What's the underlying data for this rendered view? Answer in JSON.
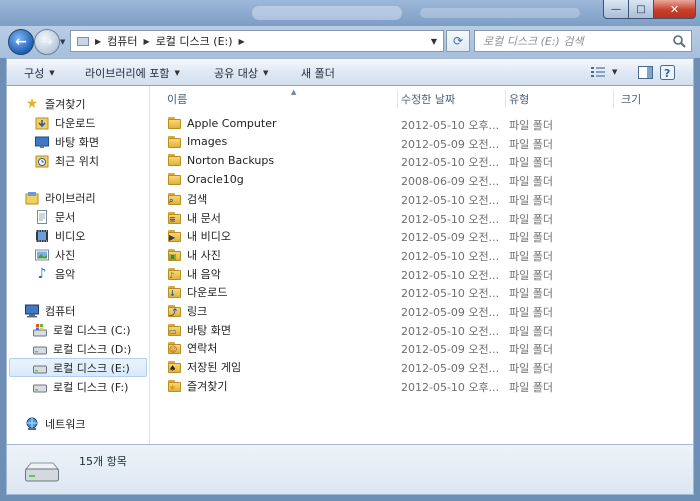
{
  "window": {
    "minimize_glyph": "—",
    "maximize_glyph": "□",
    "close_glyph": "✕"
  },
  "address": {
    "crumbs": [
      "컴퓨터",
      "로컬 디스크 (E:)"
    ]
  },
  "search": {
    "placeholder": "로컬 디스크 (E:) 검색"
  },
  "toolbar": {
    "organize": "구성",
    "include_library": "라이브러리에 포함",
    "share": "공유 대상",
    "new_folder": "새 폴더"
  },
  "nav": {
    "favorites": {
      "label": "즐겨찾기",
      "icon": "star-icon"
    },
    "favorites_items": [
      {
        "label": "다운로드",
        "icon": "downloads-folder-icon"
      },
      {
        "label": "바탕 화면",
        "icon": "desktop-icon"
      },
      {
        "label": "최근 위치",
        "icon": "recent-places-icon"
      }
    ],
    "libraries": {
      "label": "라이브러리",
      "icon": "libraries-icon"
    },
    "library_items": [
      {
        "label": "문서",
        "icon": "documents-icon"
      },
      {
        "label": "비디오",
        "icon": "videos-icon"
      },
      {
        "label": "사진",
        "icon": "pictures-icon"
      },
      {
        "label": "음악",
        "icon": "music-icon"
      }
    ],
    "computer": {
      "label": "컴퓨터",
      "icon": "computer-icon"
    },
    "drives": [
      {
        "label": "로컬 디스크 (C:)",
        "icon": "windows-drive-icon"
      },
      {
        "label": "로컬 디스크 (D:)",
        "icon": "drive-icon"
      },
      {
        "label": "로컬 디스크 (E:)",
        "icon": "drive-icon",
        "selected": true
      },
      {
        "label": "로컬 디스크 (F:)",
        "icon": "drive-icon"
      }
    ],
    "network": {
      "label": "네트워크",
      "icon": "network-icon"
    }
  },
  "columns": {
    "name": "이름",
    "modified": "수정한 날짜",
    "type": "유형",
    "size": "크기"
  },
  "files": [
    {
      "name": "Apple Computer",
      "date": "2012-05-10 오후...",
      "type": "파일 폴더",
      "icon": "folder-icon"
    },
    {
      "name": "Images",
      "date": "2012-05-09 오전...",
      "type": "파일 폴더",
      "icon": "folder-icon"
    },
    {
      "name": "Norton Backups",
      "date": "2012-05-10 오전...",
      "type": "파일 폴더",
      "icon": "folder-icon"
    },
    {
      "name": "Oracle10g",
      "date": "2008-06-09 오전...",
      "type": "파일 폴더",
      "icon": "folder-icon"
    },
    {
      "name": "검색",
      "date": "2012-05-10 오전...",
      "type": "파일 폴더",
      "icon": "search-folder-icon"
    },
    {
      "name": "내 문서",
      "date": "2012-05-10 오전...",
      "type": "파일 폴더",
      "icon": "documents-folder-icon"
    },
    {
      "name": "내 비디오",
      "date": "2012-05-09 오전...",
      "type": "파일 폴더",
      "icon": "videos-folder-icon"
    },
    {
      "name": "내 사진",
      "date": "2012-05-10 오전...",
      "type": "파일 폴더",
      "icon": "pictures-folder-icon"
    },
    {
      "name": "내 음악",
      "date": "2012-05-10 오전...",
      "type": "파일 폴더",
      "icon": "music-folder-icon"
    },
    {
      "name": "다운로드",
      "date": "2012-05-10 오전...",
      "type": "파일 폴더",
      "icon": "downloads-folder-icon"
    },
    {
      "name": "링크",
      "date": "2012-05-09 오전...",
      "type": "파일 폴더",
      "icon": "links-folder-icon"
    },
    {
      "name": "바탕 화면",
      "date": "2012-05-10 오전...",
      "type": "파일 폴더",
      "icon": "desktop-folder-icon"
    },
    {
      "name": "연락처",
      "date": "2012-05-09 오전...",
      "type": "파일 폴더",
      "icon": "contacts-folder-icon"
    },
    {
      "name": "저장된 게임",
      "date": "2012-05-09 오전...",
      "type": "파일 폴더",
      "icon": "saved-games-folder-icon"
    },
    {
      "name": "즐겨찾기",
      "date": "2012-05-10 오후...",
      "type": "파일 폴더",
      "icon": "favorites-folder-icon"
    }
  ],
  "status": {
    "count": "15개 항목"
  },
  "colors": {
    "accent": "#1f5fb6",
    "folder": "#f0c95a",
    "selection": "#d9e9fb"
  }
}
